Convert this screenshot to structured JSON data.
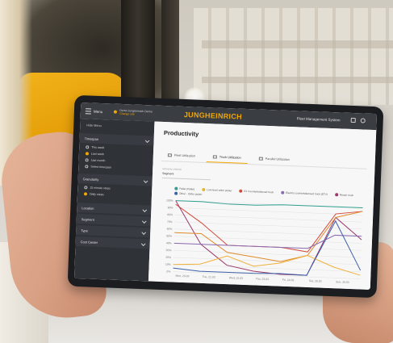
{
  "topbar": {
    "menu_label": "Menu",
    "site_name": "Demo Jungheinrich Demo",
    "site_sub": "Change site",
    "logo": "JUNGHEINRICH",
    "system_name": "Fleet Management System"
  },
  "sidebar": {
    "hide_label": "Hide Menu",
    "sections": [
      {
        "label": "Timespan"
      },
      {
        "label": "Granularity"
      },
      {
        "label": "Location"
      },
      {
        "label": "Segment"
      },
      {
        "label": "Type"
      },
      {
        "label": "Cost Center"
      }
    ],
    "timespan_options": [
      "This week",
      "Last week",
      "Last month",
      "Select timespan"
    ],
    "timespan_selected": 1,
    "granularity_options": [
      "15 minute steps",
      "Daily steps"
    ],
    "granularity_selected": 1
  },
  "main": {
    "title": "Productivity",
    "tabs": [
      "Fleet Utilization",
      "Truck Utilization",
      "Parallel Utilization"
    ],
    "active_tab": 1,
    "filter_label": "Group by criterion",
    "filter_value": "Segment"
  },
  "colors": {
    "accent": "#f3a800",
    "topbar": "#3a3d42",
    "sidebar": "#2f3237"
  },
  "chart_data": {
    "type": "line",
    "categories": [
      "Mon, 20.03",
      "Tue, 21.03",
      "Wed, 22.03",
      "Thu, 23.03",
      "Fri, 24.03",
      "Sat, 25.03",
      "Sun, 26.03"
    ],
    "yticks": [
      "100%",
      "90%",
      "80%",
      "70%",
      "60%",
      "50%",
      "40%",
      "30%",
      "20%",
      "10%",
      "0%"
    ],
    "ylim": [
      0,
      100
    ],
    "legend_labels": [
      "Pallet (Pallet)",
      "Low-level order picker",
      "EJ Counterbalanced truck",
      "Electric counterbalanced truck (ETV)",
      "Reach truck",
      "Other - Order picker"
    ],
    "series": [
      {
        "color": "#2f9e8f",
        "values": [
          100,
          100,
          98,
          98,
          100,
          100,
          100,
          100
        ]
      },
      {
        "color": "#d44a3a",
        "values": [
          95,
          70,
          40,
          40,
          40,
          35,
          90,
          95
        ]
      },
      {
        "color": "#9a3a6b",
        "values": [
          100,
          40,
          12,
          5,
          2,
          2,
          85,
          55
        ]
      },
      {
        "color": "#e08a2a",
        "values": [
          55,
          55,
          30,
          25,
          20,
          30,
          85,
          95
        ]
      },
      {
        "color": "#8a6ab0",
        "values": [
          40,
          40,
          40,
          40,
          40,
          40,
          60,
          60
        ]
      },
      {
        "color": "#f0b13c",
        "values": [
          10,
          12,
          25,
          12,
          18,
          30,
          15,
          5
        ]
      },
      {
        "color": "#3b5fa8",
        "values": [
          5,
          2,
          2,
          2,
          3,
          2,
          80,
          12
        ]
      }
    ]
  }
}
